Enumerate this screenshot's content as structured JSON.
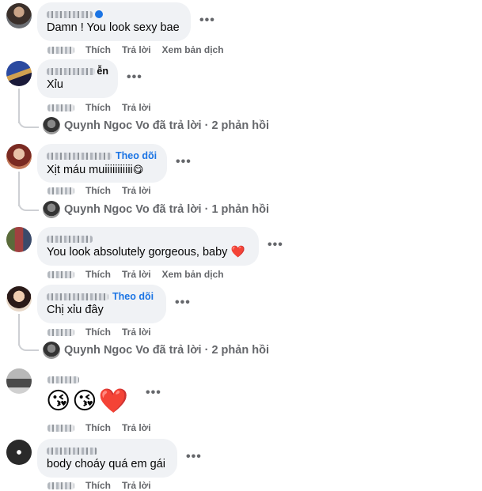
{
  "actions": {
    "like": "Thích",
    "reply": "Trả lời",
    "translate": "Xem bản dịch"
  },
  "follow_label": "Theo dõi",
  "more_icon": "•••",
  "comments": [
    {
      "text": "Damn ! You look sexy bae"
    },
    {
      "text": "Xỉu",
      "replies": "Quynh Ngoc Vo đã trả lời · 2 phản hồi"
    },
    {
      "text": "Xịt máu muiiiiiiiiiii",
      "replies": "Quynh Ngoc Vo đã trả lời · 1 phản hồi"
    },
    {
      "text": "You look absolutely gorgeous, baby"
    },
    {
      "text": "Chị xỉu đây",
      "replies": "Quynh Ngoc Vo đã trả lời · 2 phản hồi"
    },
    {
      "text": ""
    },
    {
      "text": "body choáy quá em gái"
    }
  ],
  "partial_name": "ễn",
  "colors": {
    "bubble": "#f0f2f5",
    "link_blue": "#1b74e4",
    "meta_gray": "#65676b",
    "thread_line": "#ced0d4",
    "heart": "#e41e3f"
  }
}
